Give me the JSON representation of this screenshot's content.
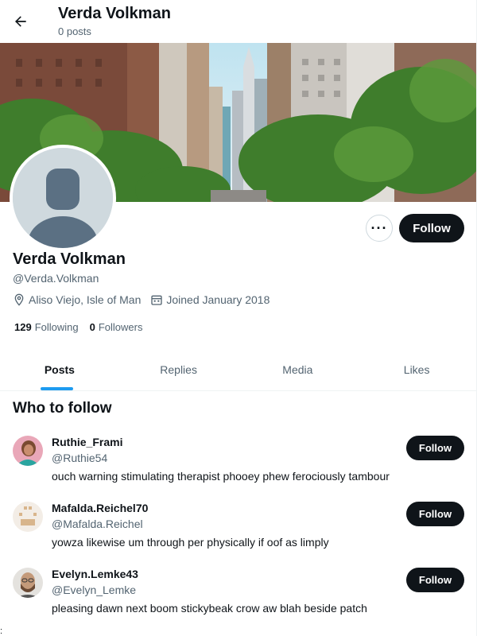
{
  "header": {
    "title": "Verda Volkman",
    "subtitle": "0 posts",
    "back_icon": "arrow-left-icon"
  },
  "profile": {
    "name": "Verda Volkman",
    "handle": "@Verda.Volkman",
    "location": "Aliso Viejo, Isle of Man",
    "joined": "Joined January 2018",
    "following_count": "129",
    "following_label": "Following",
    "followers_count": "0",
    "followers_label": "Followers",
    "follow_label": "Follow",
    "more_label": "···"
  },
  "tabs": [
    {
      "label": "Posts",
      "active": true
    },
    {
      "label": "Replies",
      "active": false
    },
    {
      "label": "Media",
      "active": false
    },
    {
      "label": "Likes",
      "active": false
    }
  ],
  "who_to_follow": {
    "title": "Who to follow",
    "items": [
      {
        "name": "Ruthie_Frami",
        "handle": "@Ruthie54",
        "bio": "ouch warning stimulating therapist phooey phew ferociously tambour",
        "follow_label": "Follow"
      },
      {
        "name": "Mafalda.Reichel70",
        "handle": "@Mafalda.Reichel",
        "bio": "yowza likewise um through per physically if oof as limply",
        "follow_label": "Follow"
      },
      {
        "name": "Evelyn.Lemke43",
        "handle": "@Evelyn_Lemke",
        "bio": "pleasing dawn next boom stickybeak crow aw blah beside patch",
        "follow_label": "Follow"
      }
    ]
  },
  "stray_text": ":",
  "colors": {
    "accent": "#1d9bf0",
    "text": "#0f1419",
    "muted": "#536471",
    "button": "#0f1419"
  }
}
